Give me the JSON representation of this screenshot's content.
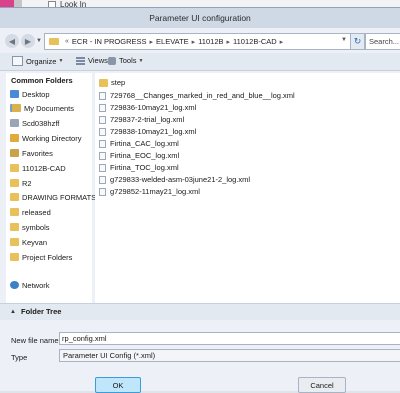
{
  "background": {
    "partial_text": "Look In"
  },
  "dialog": {
    "title": "Parameter UI configuration"
  },
  "address_bar": {
    "breadcrumbs": [
      "ECR - IN PROGRESS",
      "ELEVATE",
      "11012B",
      "11012B-CAD"
    ],
    "search_placeholder": "Search..."
  },
  "toolbar": {
    "organize_label": "Organize",
    "views_label": "Views",
    "tools_label": "Tools"
  },
  "sidebar": {
    "header": "Common Folders",
    "items": [
      {
        "label": "Desktop",
        "icon": "desktop-icon"
      },
      {
        "label": "My Documents",
        "icon": "documents-icon"
      },
      {
        "label": "Scd038hzff",
        "icon": "drive-icon"
      },
      {
        "label": "Working Directory",
        "icon": "working-directory-icon"
      },
      {
        "label": "Favorites",
        "icon": "favorites-icon"
      },
      {
        "label": "11012B-CAD",
        "icon": "folder-icon"
      },
      {
        "label": "R2",
        "icon": "folder-icon"
      },
      {
        "label": "DRAWING FORMATS",
        "icon": "folder-icon"
      },
      {
        "label": "released",
        "icon": "folder-icon"
      },
      {
        "label": "symbols",
        "icon": "folder-icon"
      },
      {
        "label": "Keyvan",
        "icon": "folder-icon"
      },
      {
        "label": "Project Folders",
        "icon": "folder-icon"
      },
      {
        "label": "Network",
        "icon": "network-icon"
      }
    ]
  },
  "files": [
    {
      "name": "step",
      "type": "folder"
    },
    {
      "name": "729768__Changes_marked_in_red_and_blue__log.xml",
      "type": "file"
    },
    {
      "name": "729836-10may21_log.xml",
      "type": "file"
    },
    {
      "name": "729837-2-trial_log.xml",
      "type": "file"
    },
    {
      "name": "729838-10may21_log.xml",
      "type": "file"
    },
    {
      "name": "Firtina_CAC_log.xml",
      "type": "file"
    },
    {
      "name": "Firtina_EOC_log.xml",
      "type": "file"
    },
    {
      "name": "Firtina_TOC_log.xml",
      "type": "file"
    },
    {
      "name": "g729833-welded-asm-03june21-2_log.xml",
      "type": "file"
    },
    {
      "name": "g729852-11may21_log.xml",
      "type": "file"
    }
  ],
  "folder_tree": {
    "label": "Folder Tree"
  },
  "form": {
    "file_name_label": "New file name",
    "file_name_value": "rp_config.xml",
    "type_label": "Type",
    "type_value": "Parameter UI Config (*.xml)"
  },
  "buttons": {
    "ok": "OK",
    "cancel": "Cancel"
  }
}
